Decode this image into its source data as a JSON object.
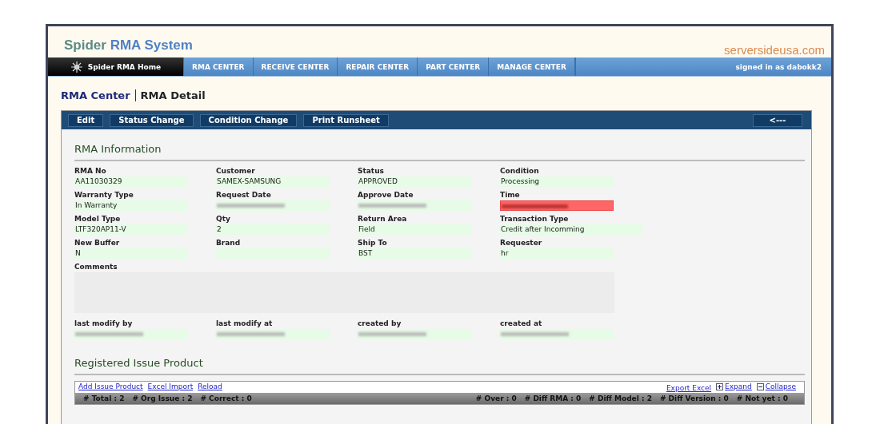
{
  "header": {
    "title_first": "Spider",
    "title_rest": "RMA System",
    "site": "serversideusa.com"
  },
  "nav": {
    "items": [
      {
        "label": "Spider RMA Home",
        "kind": "home",
        "selected": true
      },
      {
        "label": "RMA CENTER",
        "kind": "menu",
        "selected": false
      },
      {
        "label": "RECEIVE CENTER",
        "kind": "menu",
        "selected": false
      },
      {
        "label": "REPAIR CENTER",
        "kind": "menu",
        "selected": false
      },
      {
        "label": "PART CENTER",
        "kind": "menu",
        "selected": false
      },
      {
        "label": "MANAGE CENTER",
        "kind": "menu",
        "selected": false
      }
    ],
    "user": "signed in as dabokk2"
  },
  "breadcrumb": {
    "parent": "RMA Center",
    "current": "RMA Detail"
  },
  "toolbar": {
    "buttons": [
      "Edit",
      "Status Change",
      "Condition Change",
      "Print Runsheet"
    ],
    "back": "<---"
  },
  "rma_information": {
    "title": "RMA Information",
    "fields": [
      {
        "label": "RMA No",
        "value": "AA11030329"
      },
      {
        "label": "Customer",
        "value": "SAMEX-SAMSUNG"
      },
      {
        "label": "Status",
        "value": "APPROVED"
      },
      {
        "label": "Condition",
        "value": "Processing"
      },
      {
        "label": "Warranty Type",
        "value": "In Warranty"
      },
      {
        "label": "Request Date",
        "redacted": true
      },
      {
        "label": "Approve Date",
        "redacted": true
      },
      {
        "label": "Time",
        "redacted": true,
        "alert": true
      },
      {
        "label": "Model Type",
        "value": "LTF320AP11-V"
      },
      {
        "label": "Qty",
        "value": "2"
      },
      {
        "label": "Return Area",
        "value": "Field"
      },
      {
        "label": "Transaction Type",
        "value": "Credit after Incomming",
        "wide": true
      },
      {
        "label": "New Buffer",
        "value": "N"
      },
      {
        "label": "Brand"
      },
      {
        "label": "Ship To",
        "value": "BST"
      },
      {
        "label": "Requester",
        "value": "hr"
      },
      {
        "label": "Comments",
        "kind": "textarea"
      },
      {
        "label": "last modify by",
        "redacted": true
      },
      {
        "label": "last modify at",
        "redacted": true
      },
      {
        "label": "created by",
        "redacted": true
      },
      {
        "label": "created at",
        "redacted": true
      }
    ]
  },
  "registered_issue_product": {
    "title": "Registered Issue Product",
    "actions_left": [
      {
        "label": "Add Issue Product",
        "kind": "link"
      },
      {
        "label": "Excel Import",
        "kind": "link"
      },
      {
        "label": "Reload",
        "kind": "link"
      }
    ],
    "actions_right": [
      {
        "label": "Export Excel",
        "kind": "link"
      },
      {
        "label": "Expand",
        "kind": "expand"
      },
      {
        "label": "Collapse",
        "kind": "collapse"
      }
    ],
    "stats_left": [
      "# Total : 2",
      "# Org Issue : 2",
      "# Correct : 0"
    ],
    "stats_right": [
      "# Over : 0",
      "# Diff RMA : 0",
      "# Diff Model : 2",
      "# Diff Version : 0",
      "# Not yet : 0"
    ]
  }
}
